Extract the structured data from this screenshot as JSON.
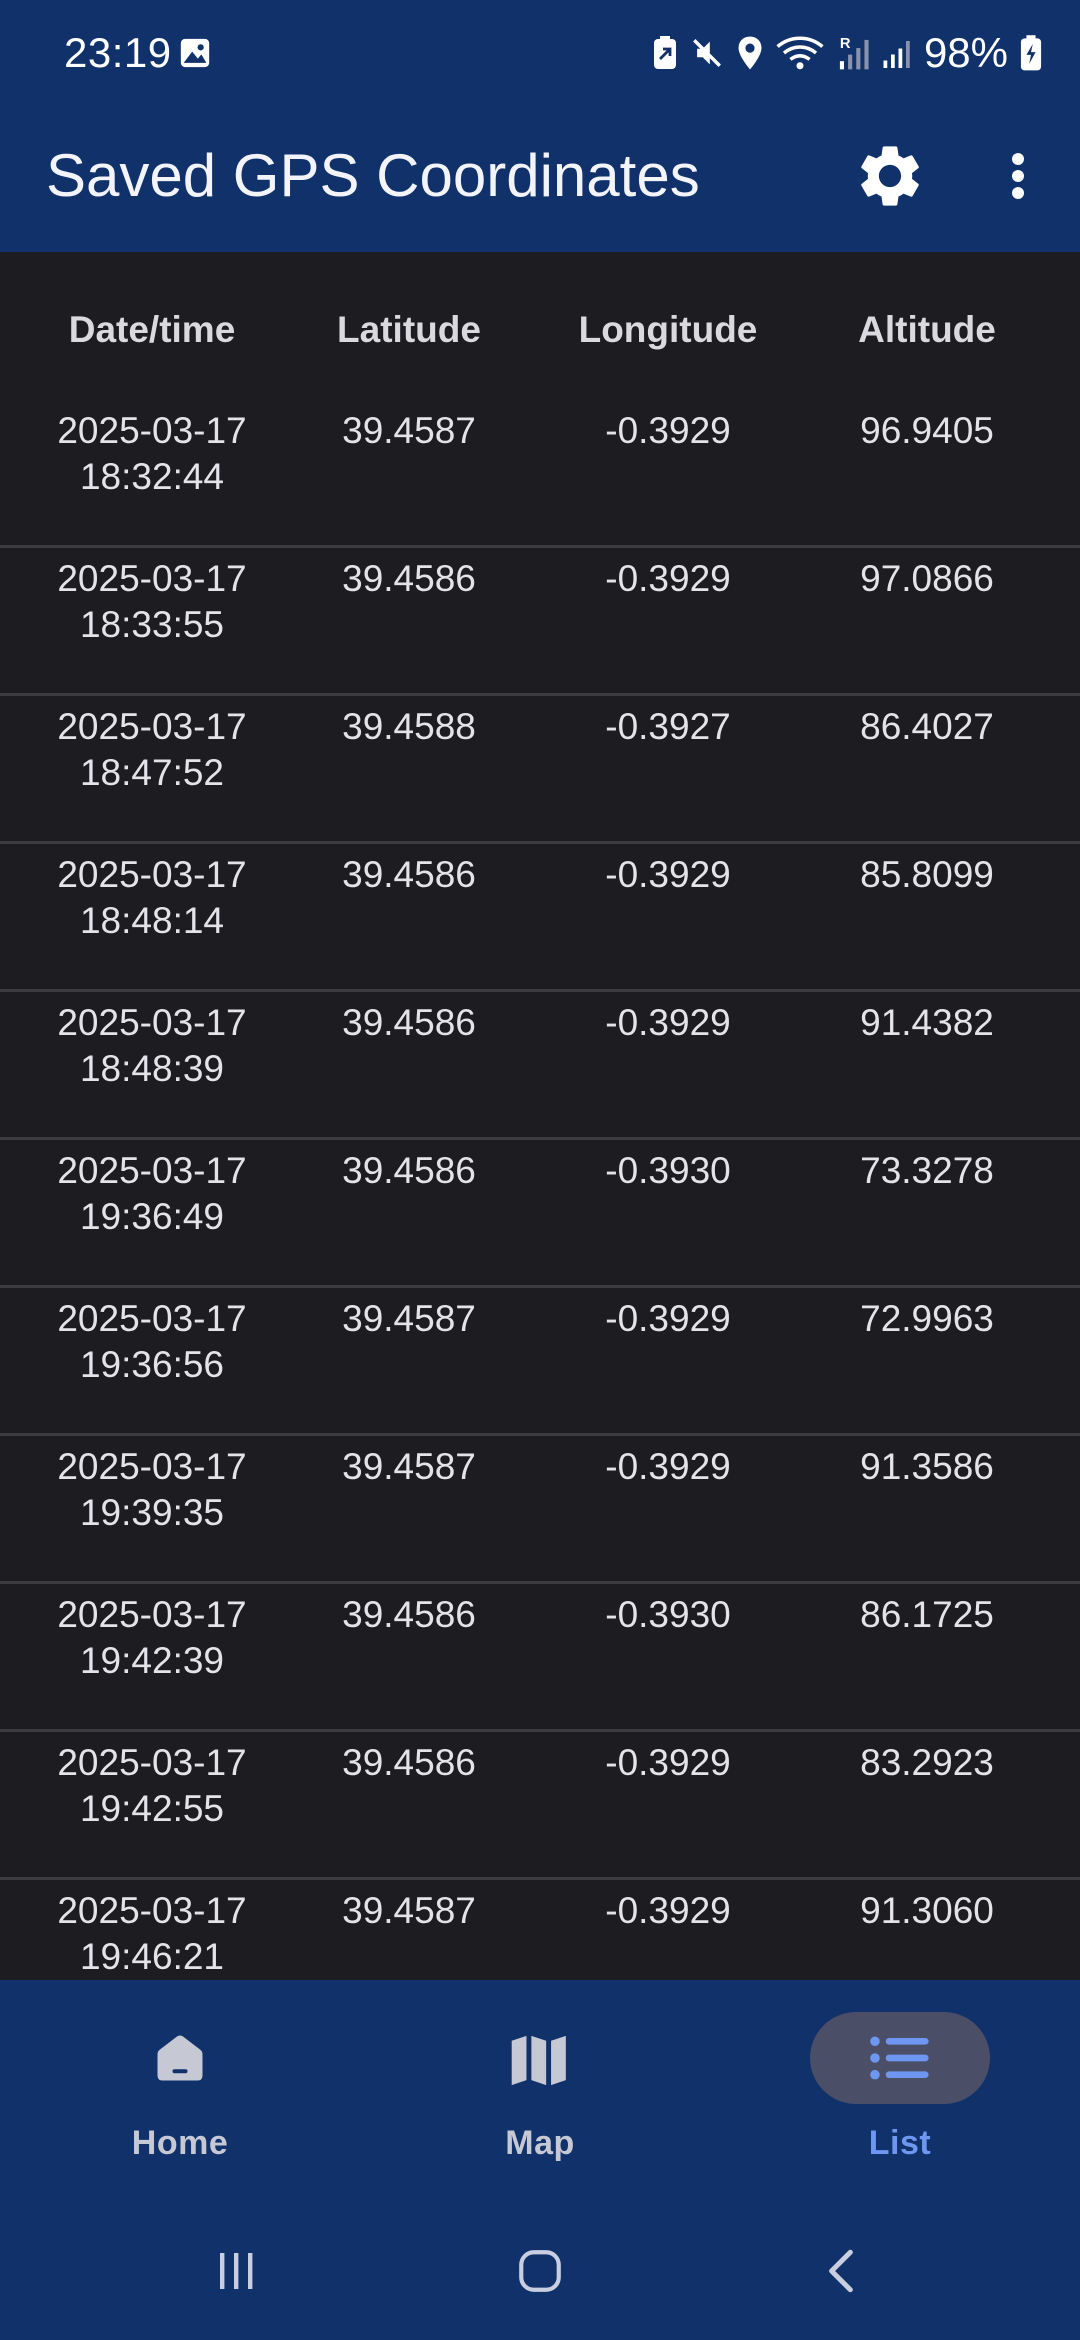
{
  "status_bar": {
    "time": "23:19",
    "battery_percent": "98%"
  },
  "app_bar": {
    "title": "Saved GPS Coordinates"
  },
  "table": {
    "headers": [
      "Date/time",
      "Latitude",
      "Longitude",
      "Altitude"
    ],
    "rows": [
      {
        "date": "2025-03-17",
        "time": "18:32:44",
        "lat": "39.4587",
        "lon": "-0.3929",
        "alt": "96.9405"
      },
      {
        "date": "2025-03-17",
        "time": "18:33:55",
        "lat": "39.4586",
        "lon": "-0.3929",
        "alt": "97.0866"
      },
      {
        "date": "2025-03-17",
        "time": "18:47:52",
        "lat": "39.4588",
        "lon": "-0.3927",
        "alt": "86.4027"
      },
      {
        "date": "2025-03-17",
        "time": "18:48:14",
        "lat": "39.4586",
        "lon": "-0.3929",
        "alt": "85.8099"
      },
      {
        "date": "2025-03-17",
        "time": "18:48:39",
        "lat": "39.4586",
        "lon": "-0.3929",
        "alt": "91.4382"
      },
      {
        "date": "2025-03-17",
        "time": "19:36:49",
        "lat": "39.4586",
        "lon": "-0.3930",
        "alt": "73.3278"
      },
      {
        "date": "2025-03-17",
        "time": "19:36:56",
        "lat": "39.4587",
        "lon": "-0.3929",
        "alt": "72.9963"
      },
      {
        "date": "2025-03-17",
        "time": "19:39:35",
        "lat": "39.4587",
        "lon": "-0.3929",
        "alt": "91.3586"
      },
      {
        "date": "2025-03-17",
        "time": "19:42:39",
        "lat": "39.4586",
        "lon": "-0.3930",
        "alt": "86.1725"
      },
      {
        "date": "2025-03-17",
        "time": "19:42:55",
        "lat": "39.4586",
        "lon": "-0.3929",
        "alt": "83.2923"
      },
      {
        "date": "2025-03-17",
        "time": "19:46:21",
        "lat": "39.4587",
        "lon": "-0.3929",
        "alt": "91.3060"
      }
    ]
  },
  "bottom_nav": {
    "items": [
      {
        "label": "Home",
        "icon": "home-icon",
        "selected": false
      },
      {
        "label": "Map",
        "icon": "map-icon",
        "selected": false
      },
      {
        "label": "List",
        "icon": "list-icon",
        "selected": true
      }
    ]
  },
  "colors": {
    "app_bar": "#10316a",
    "background": "#1d1c21",
    "accent": "#6d97f0"
  }
}
